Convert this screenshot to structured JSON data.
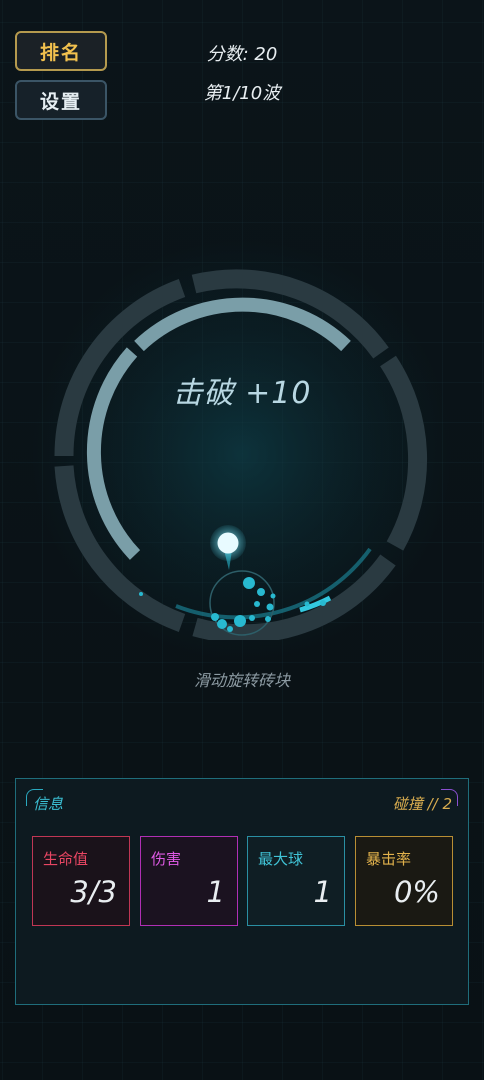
{
  "hud": {
    "rank_button": "排名",
    "settings_button": "设置",
    "score": "分数: 20",
    "wave": "第1/10波"
  },
  "game": {
    "popup_text": "击破 +10",
    "hint": "滑动旋转砖块"
  },
  "info_panel": {
    "title": "信息",
    "collide": "碰撞 // 2",
    "stats": {
      "hp": {
        "label": "生命值",
        "value": "3/3"
      },
      "damage": {
        "label": "伤害",
        "value": "1"
      },
      "max_balls": {
        "label": "最大球",
        "value": "1"
      },
      "crit_rate": {
        "label": "暴击率",
        "value": "0%"
      }
    }
  },
  "colors": {
    "accent_gold": "#f2c14e",
    "accent_cyan": "#3bc0d4",
    "hp_red": "#e84663",
    "damage_magenta": "#e05ae6",
    "crit_gold": "#e2b24c",
    "ball": "#e8fbff"
  }
}
